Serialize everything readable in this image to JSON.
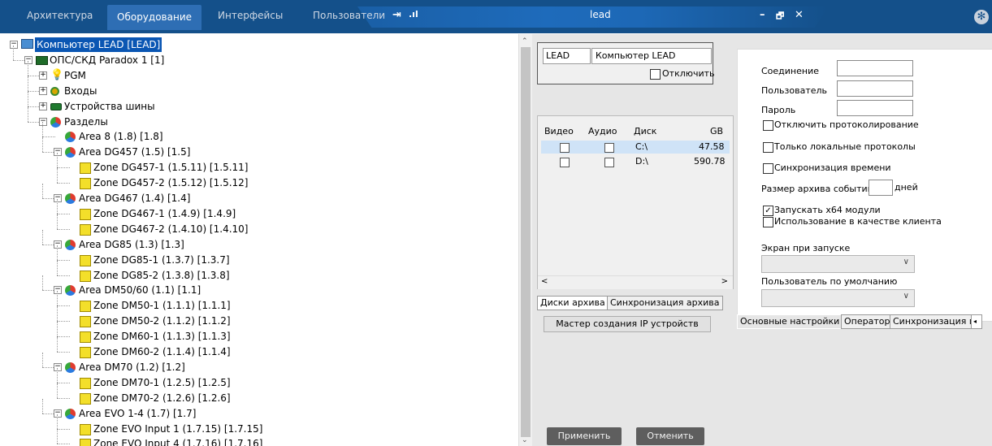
{
  "tabs": [
    "Архитектура",
    "Оборудование",
    "Интерфейсы",
    "Пользователи"
  ],
  "active_tab": 1,
  "window": {
    "title": "lead",
    "min": "–",
    "restore": "🗗",
    "close": "✕"
  },
  "tree": [
    {
      "label": "Компьютер LEAD [LEAD]",
      "level": 0,
      "icon": "pc",
      "expander": "−",
      "selected": true
    },
    {
      "label": "ОПС/СКД Paradox 1 [1]",
      "level": 1,
      "icon": "dev",
      "expander": "−"
    },
    {
      "label": "PGM",
      "level": 2,
      "icon": "bulb",
      "expander": "+"
    },
    {
      "label": "Входы",
      "level": 2,
      "icon": "dot",
      "expander": "+"
    },
    {
      "label": "Устройства шины",
      "level": 2,
      "icon": "bus",
      "expander": "+"
    },
    {
      "label": "Разделы",
      "level": 2,
      "icon": "area",
      "expander": "−"
    },
    {
      "label": "Area 8 (1.8) [1.8]",
      "level": 3,
      "icon": "area",
      "expander": ""
    },
    {
      "label": "Area DG457 (1.5) [1.5]",
      "level": 3,
      "icon": "area",
      "expander": "−"
    },
    {
      "label": "Zone DG457-1 (1.5.11) [1.5.11]",
      "level": 4,
      "icon": "zone",
      "expander": ""
    },
    {
      "label": "Zone DG457-2 (1.5.12) [1.5.12]",
      "level": 4,
      "icon": "zone",
      "expander": ""
    },
    {
      "label": "Area DG467 (1.4) [1.4]",
      "level": 3,
      "icon": "area",
      "expander": "−"
    },
    {
      "label": "Zone DG467-1 (1.4.9) [1.4.9]",
      "level": 4,
      "icon": "zone",
      "expander": ""
    },
    {
      "label": "Zone DG467-2 (1.4.10) [1.4.10]",
      "level": 4,
      "icon": "zone",
      "expander": ""
    },
    {
      "label": "Area DG85 (1.3) [1.3]",
      "level": 3,
      "icon": "area",
      "expander": "−"
    },
    {
      "label": "Zone DG85-1 (1.3.7) [1.3.7]",
      "level": 4,
      "icon": "zone",
      "expander": ""
    },
    {
      "label": "Zone DG85-2 (1.3.8) [1.3.8]",
      "level": 4,
      "icon": "zone",
      "expander": ""
    },
    {
      "label": "Area DM50/60 (1.1) [1.1]",
      "level": 3,
      "icon": "area",
      "expander": "−"
    },
    {
      "label": "Zone DM50-1 (1.1.1) [1.1.1]",
      "level": 4,
      "icon": "zone",
      "expander": ""
    },
    {
      "label": "Zone DM50-2 (1.1.2) [1.1.2]",
      "level": 4,
      "icon": "zone",
      "expander": ""
    },
    {
      "label": "Zone DM60-1 (1.1.3) [1.1.3]",
      "level": 4,
      "icon": "zone",
      "expander": ""
    },
    {
      "label": "Zone DM60-2 (1.1.4) [1.1.4]",
      "level": 4,
      "icon": "zone",
      "expander": ""
    },
    {
      "label": "Area DM70 (1.2) [1.2]",
      "level": 3,
      "icon": "area",
      "expander": "−"
    },
    {
      "label": "Zone DM70-1 (1.2.5) [1.2.5]",
      "level": 4,
      "icon": "zone",
      "expander": ""
    },
    {
      "label": "Zone DM70-2 (1.2.6) [1.2.6]",
      "level": 4,
      "icon": "zone",
      "expander": ""
    },
    {
      "label": "Area EVO 1-4 (1.7) [1.7]",
      "level": 3,
      "icon": "area",
      "expander": "−"
    },
    {
      "label": "Zone EVO Input 1 (1.7.15) [1.7.15]",
      "level": 4,
      "icon": "zone",
      "expander": ""
    },
    {
      "label": "Zone EVO Input 4 (1.7.16) [1.7.16]",
      "level": 4,
      "icon": "zone",
      "expander": ""
    }
  ],
  "obj": {
    "id": "LEAD",
    "name": "Компьютер LEAD",
    "disable_label": "Отключить"
  },
  "disks": {
    "columns": [
      "Видео",
      "Аудио",
      "Диск",
      "GB"
    ],
    "rows": [
      {
        "disk": "C:\\",
        "gb": "47.58"
      },
      {
        "disk": "D:\\",
        "gb": "590.78"
      }
    ]
  },
  "left_tabs": [
    "Диски архива",
    "Синхронизация архива"
  ],
  "ip_wizard": "Мастер создания IP устройств",
  "settings": {
    "connection": "Соединение",
    "user": "Пользователь",
    "password": "Пароль",
    "disable_log": "Отключить протоколирование",
    "local_logs": "Только локальные протоколы",
    "time_sync": "Синхронизация времени",
    "archive_size": "Размер архива событий",
    "days": "дней",
    "run_x64": "Запускать x64 модули",
    "as_client": "Использование в качестве клиента",
    "screen_start": "Экран при запуске",
    "default_user": "Пользователь по умолчанию"
  },
  "right_tabs": [
    "Основные настройки",
    "Оператор",
    "Синхронизация пр"
  ],
  "apply": "Применить",
  "cancel": "Отменить"
}
